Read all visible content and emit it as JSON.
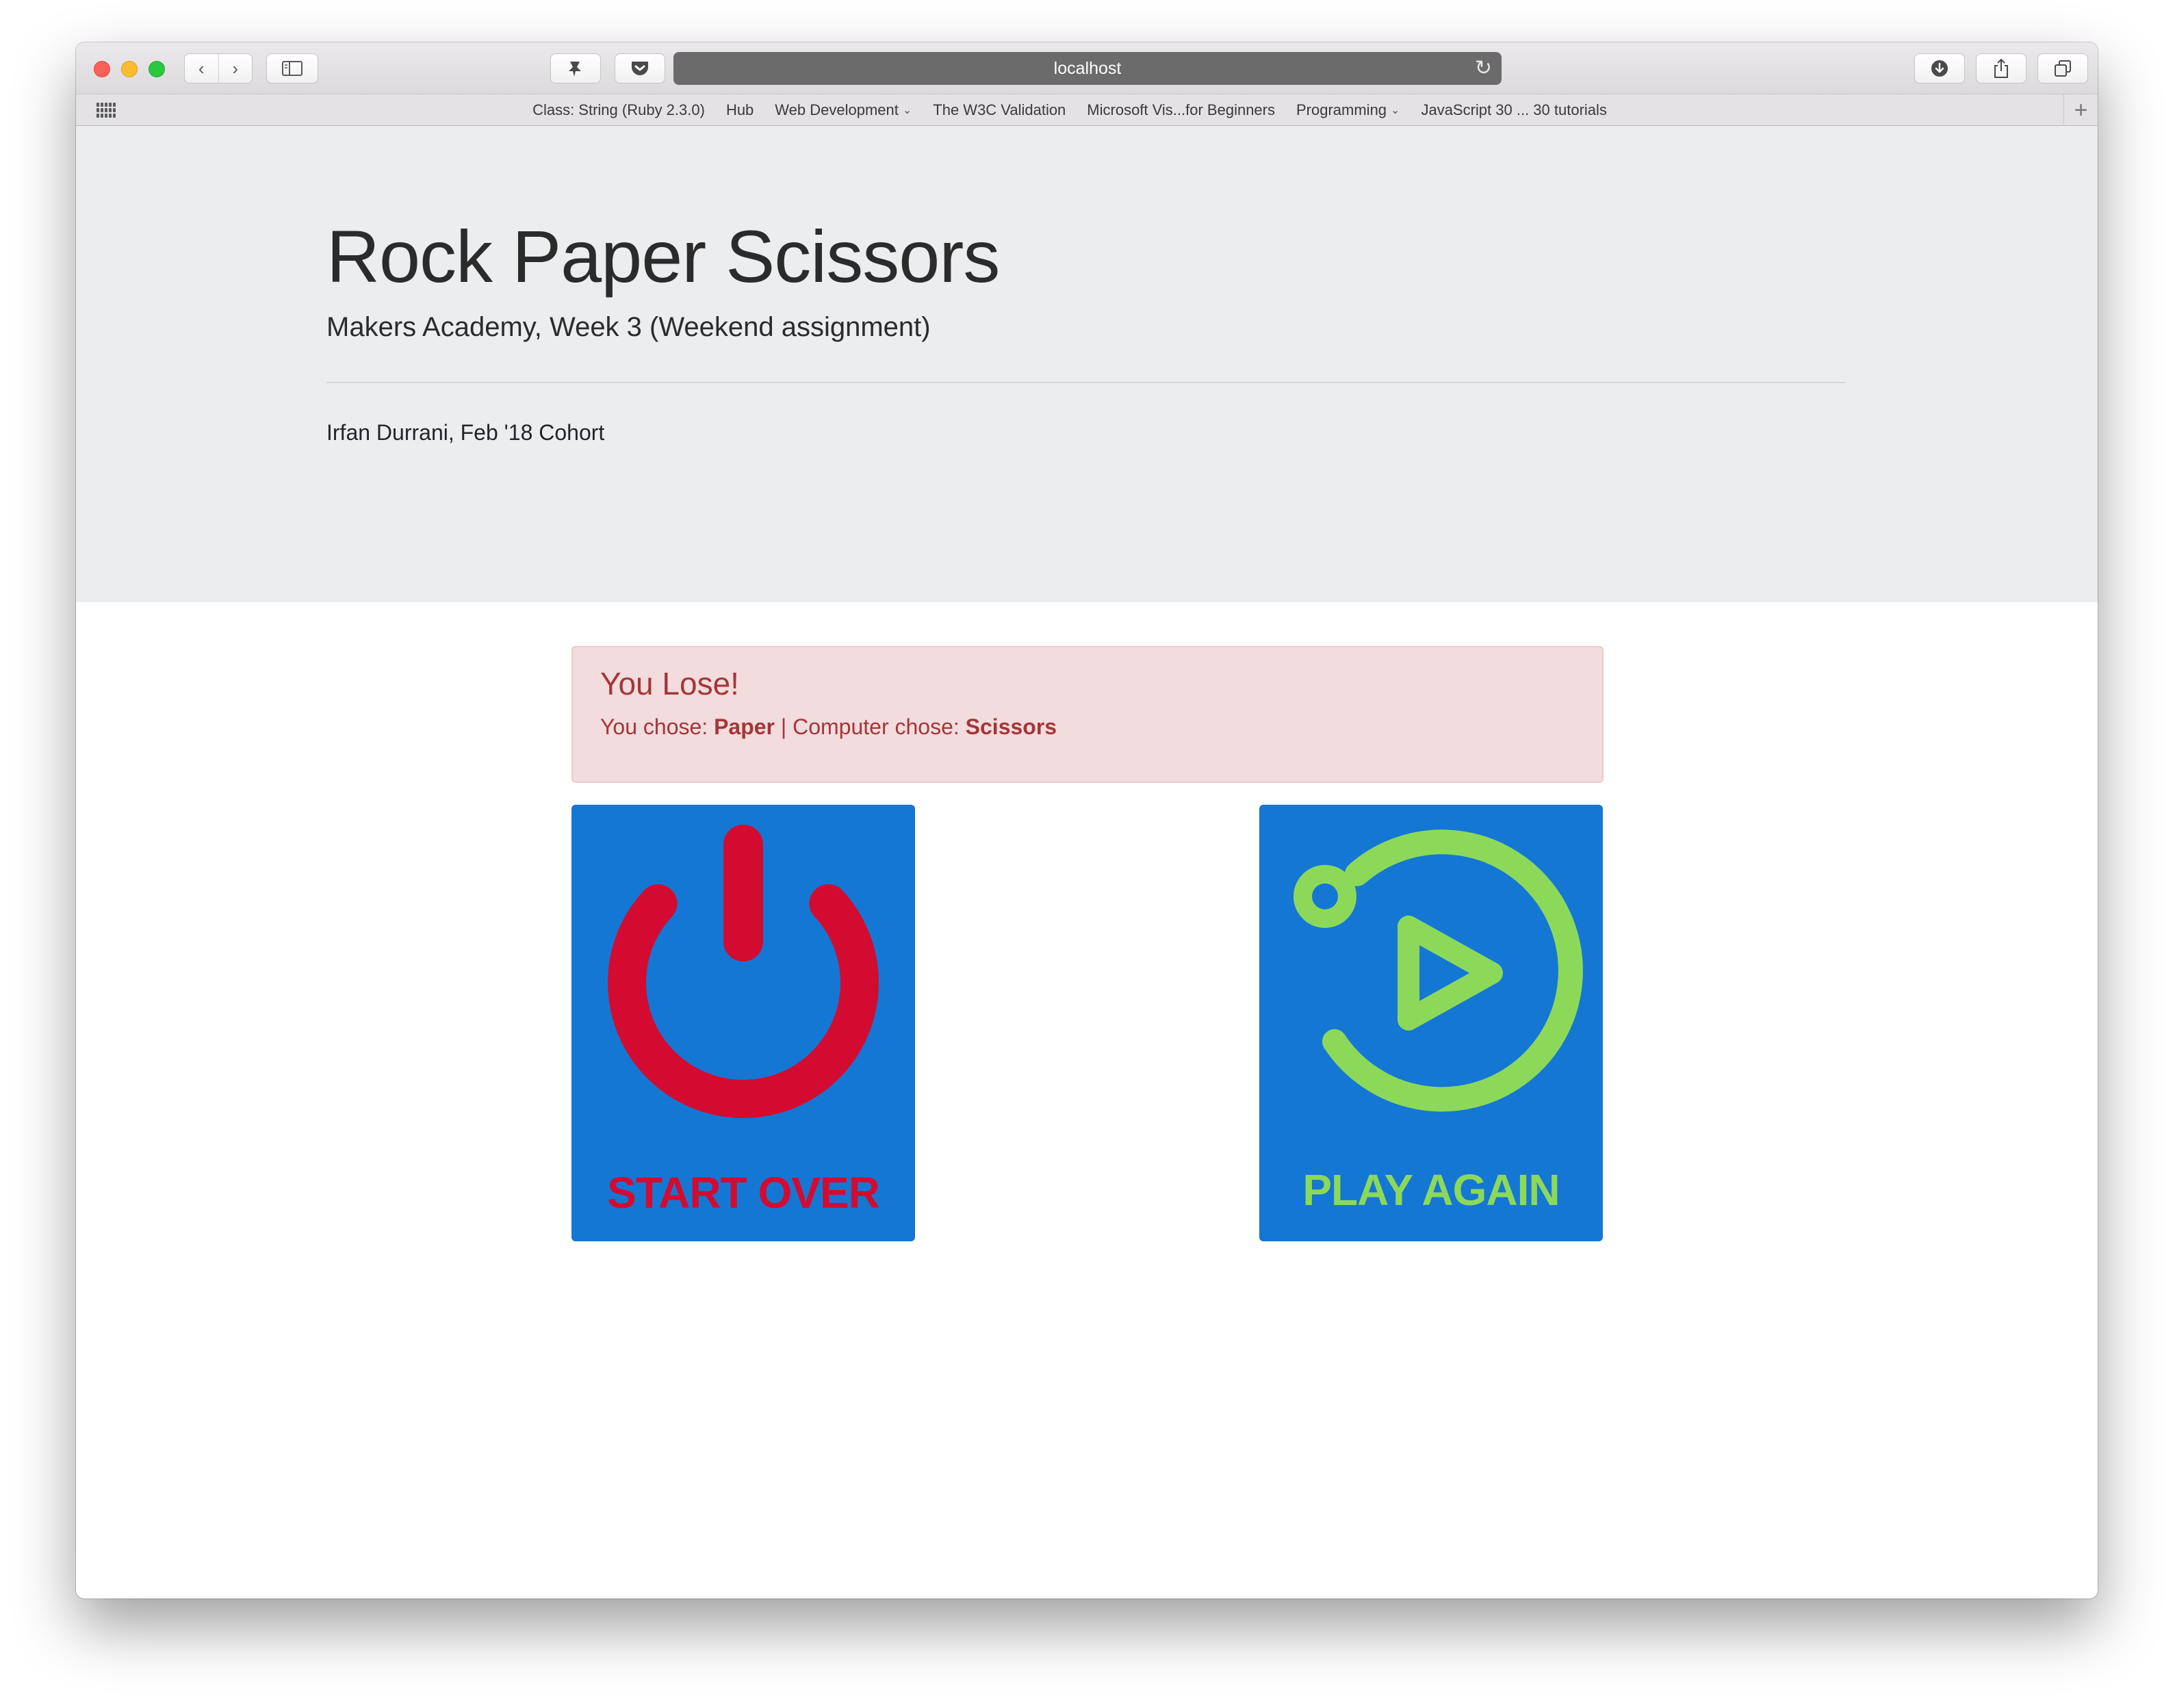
{
  "browser": {
    "url": "localhost",
    "nav_back": "‹",
    "nav_forward": "›",
    "reload_glyph": "↻",
    "bookmarks": [
      {
        "label": "Class: String (Ruby 2.3.0)"
      },
      {
        "label": "Hub"
      },
      {
        "label": "Web Development",
        "chevron": "⌄"
      },
      {
        "label": "The W3C Validation"
      },
      {
        "label": "Microsoft Vis...for Beginners"
      },
      {
        "label": "Programming",
        "chevron": "⌄"
      },
      {
        "label": "JavaScript 30 ... 30 tutorials"
      }
    ],
    "add_bookmark": "+"
  },
  "header": {
    "title": "Rock Paper Scissors",
    "subtitle": "Makers Academy, Week 3 (Weekend assignment)",
    "author": "Irfan Durrani, Feb '18 Cohort"
  },
  "result": {
    "heading": "You Lose!",
    "you_chose_label": "You chose:",
    "player_choice": "Paper",
    "separator": "|",
    "computer_chose_label": "Computer chose:",
    "computer_choice": "Scissors"
  },
  "actions": {
    "start_over": {
      "label": "START OVER",
      "icon": "power-icon",
      "color": "#d40b30"
    },
    "play_again": {
      "label": "PLAY AGAIN",
      "icon": "replay-icon",
      "color": "#8cd95a"
    },
    "tile_background": "#1477d4"
  }
}
